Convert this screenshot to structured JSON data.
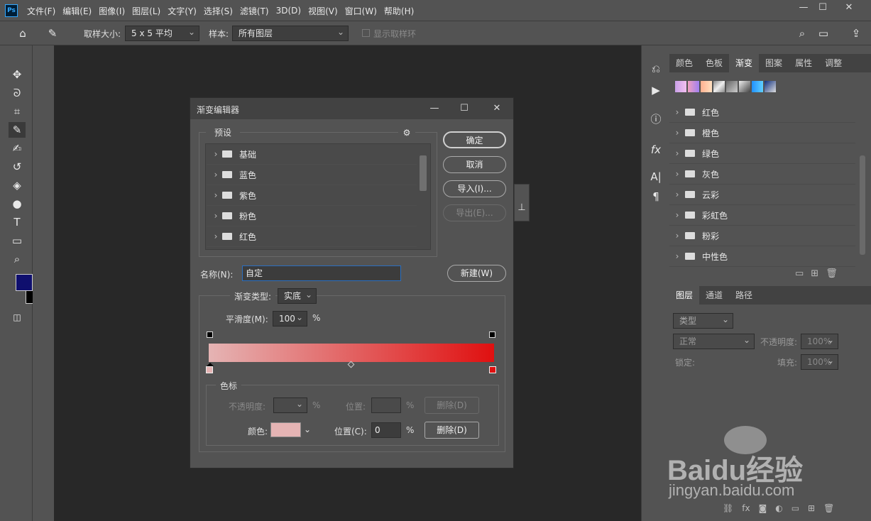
{
  "app": {
    "logo": "Ps"
  },
  "menubar": {
    "items": [
      "文件(F)",
      "编辑(E)",
      "图像(I)",
      "图层(L)",
      "文字(Y)",
      "选择(S)",
      "滤镜(T)",
      "3D(D)",
      "视图(V)",
      "窗口(W)",
      "帮助(H)"
    ]
  },
  "options_bar": {
    "sample_size_label": "取样大小:",
    "sample_size_value": "5 x 5 平均",
    "sample_label": "样本:",
    "sample_value": "所有图层",
    "show_ring_label": "显示取样环"
  },
  "gradients_panel": {
    "tabs": [
      "颜色",
      "色板",
      "渐变",
      "图案",
      "属性",
      "调整"
    ],
    "active_tab": "渐变",
    "folders": [
      "红色",
      "橙色",
      "绿色",
      "灰色",
      "云彩",
      "彩虹色",
      "粉彩",
      "中性色"
    ]
  },
  "layers_panel": {
    "tabs": [
      "图层",
      "通道",
      "路径"
    ],
    "filter_placeholder": "类型",
    "blend_mode": "正常",
    "opacity_label": "不透明度:",
    "opacity_value": "100%",
    "lock_label": "锁定:",
    "fill_label": "填充:",
    "fill_value": "100%"
  },
  "dialog": {
    "title": "渐变编辑器",
    "presets_label": "预设",
    "preset_folders": [
      "基础",
      "蓝色",
      "紫色",
      "粉色",
      "红色"
    ],
    "ok": "确定",
    "cancel": "取消",
    "import": "导入(I)...",
    "export": "导出(E)...",
    "name_label": "名称(N):",
    "name_value": "自定",
    "new_button": "新建(W)",
    "gradient_type_label": "渐变类型:",
    "gradient_type_value": "实底",
    "smoothness_label": "平滑度(M):",
    "smoothness_value": "100",
    "percent": "%",
    "stops_label": "色标",
    "opacity_label": "不透明度:",
    "location_label_disabled": "位置:",
    "delete_disabled": "删除(D)",
    "color_label": "颜色:",
    "location_label": "位置(C):",
    "location_value": "0",
    "delete": "删除(D)",
    "gradient_start": "#e5b4b4",
    "gradient_end": "#e01010"
  },
  "watermark": {
    "brand": "Baidu经验",
    "url": "jingyan.baidu.com"
  }
}
